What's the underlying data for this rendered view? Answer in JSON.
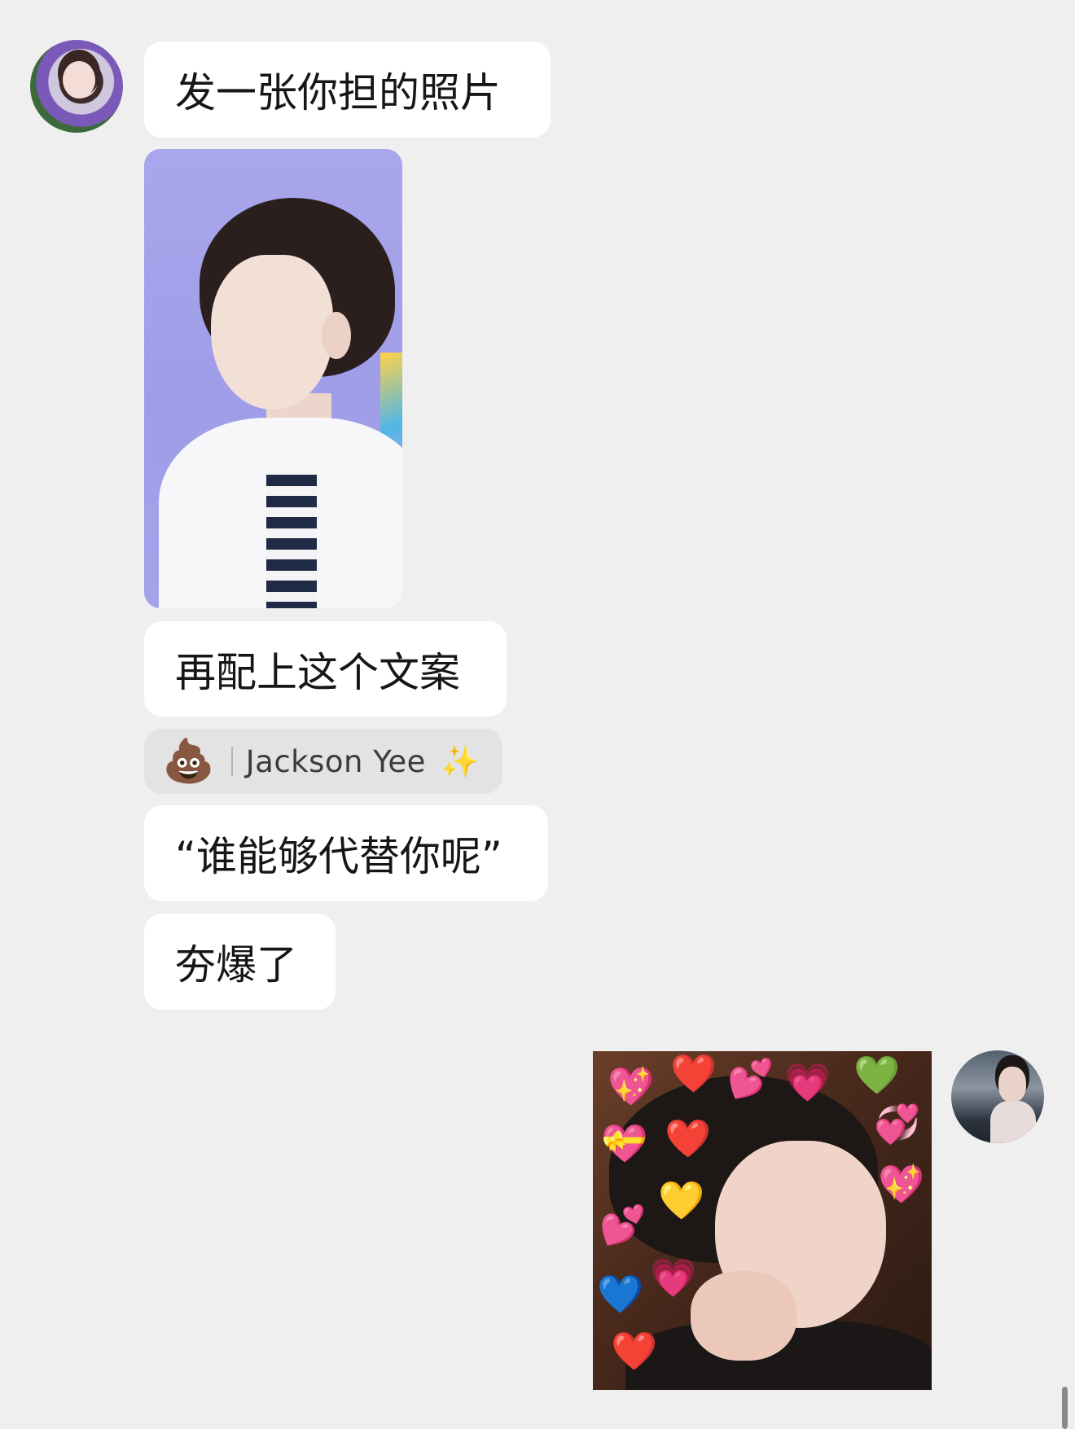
{
  "chat": {
    "messages": [
      {
        "text": "发一张你担的照片"
      },
      {
        "text": "再配上这个文案"
      },
      {
        "text": "“谁能够代替你呢”"
      },
      {
        "text": "夯爆了"
      }
    ],
    "emoji_bar": {
      "emoji": "💩",
      "name": "Jackson Yee",
      "sparkle": "✨"
    },
    "meme_hearts": [
      "💖",
      "❤️",
      "💕",
      "💗",
      "💚",
      "💝",
      "❤️",
      "💞",
      "💛",
      "💕",
      "💙",
      "❤️",
      "💗",
      "💖"
    ]
  }
}
